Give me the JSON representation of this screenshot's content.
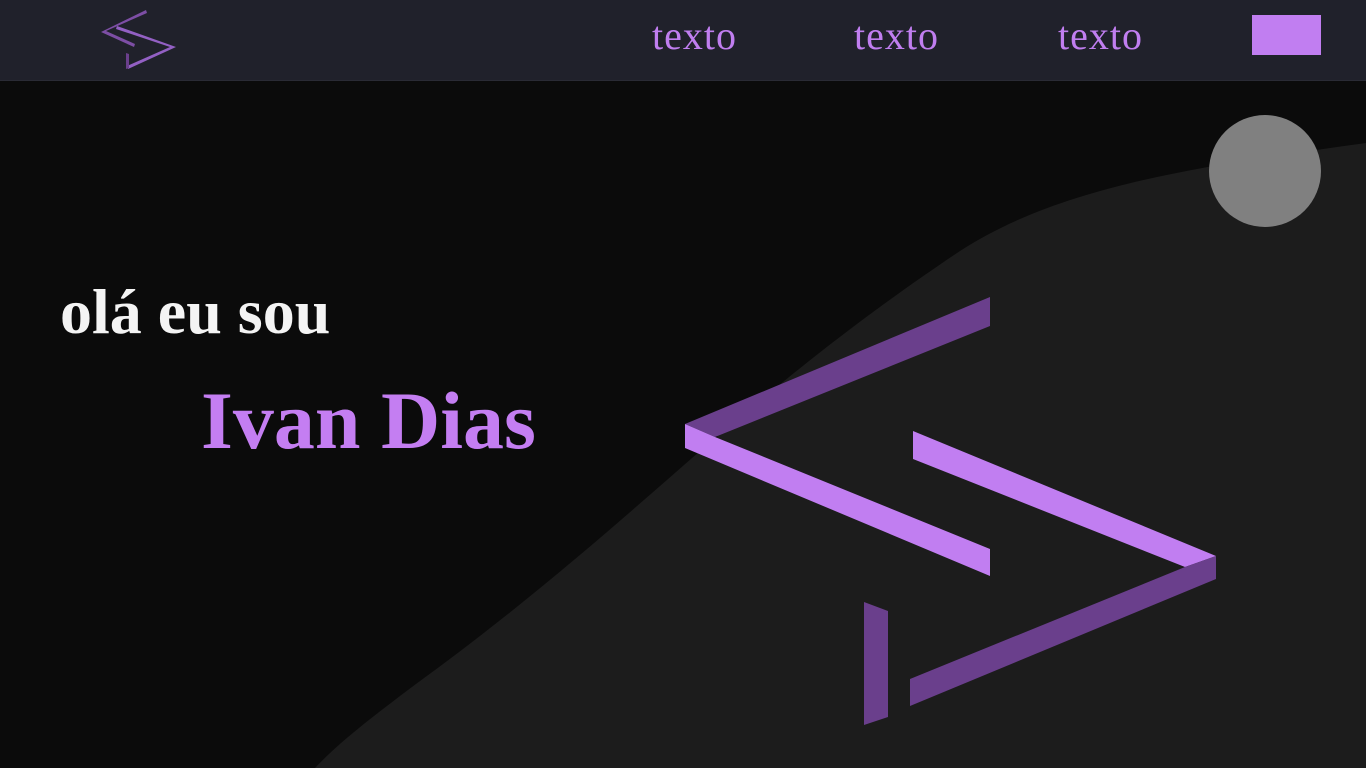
{
  "header": {
    "logo_icon": "brand-chevrons-icon",
    "nav_links": [
      {
        "label": "texto"
      },
      {
        "label": "texto"
      },
      {
        "label": "texto"
      }
    ],
    "cta_color": "#c17ef1"
  },
  "hero": {
    "greeting": "olá eu sou",
    "name": "Ivan Dias",
    "avatar": "placeholder-circle",
    "logo_icon": "chevron-logo-icon"
  },
  "colors": {
    "accent": "#c47ef2",
    "accent_dark": "#6a3f8c",
    "nav_background": "#20212b",
    "page_background": "#0b0b0b",
    "wave_background": "#1c1c1c",
    "avatar": "#808080"
  }
}
